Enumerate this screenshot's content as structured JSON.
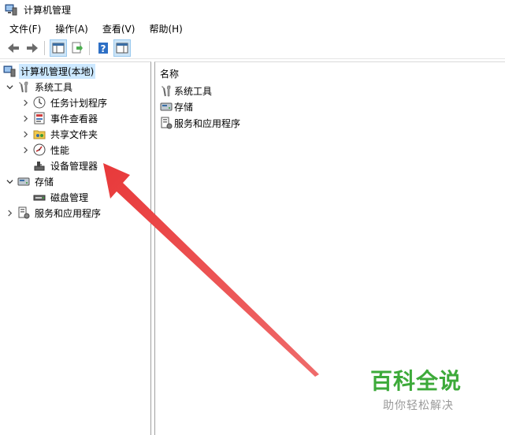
{
  "window": {
    "title": "计算机管理"
  },
  "menu": [
    "文件(F)",
    "操作(A)",
    "查看(V)",
    "帮助(H)"
  ],
  "toolbar": {
    "buttons": [
      "back-icon",
      "forward-icon",
      "show-console-tree-icon",
      "export-list-icon",
      "help-icon",
      "show-action-pane-icon"
    ]
  },
  "tree": {
    "root": "计算机管理(本地)",
    "system_tools": {
      "label": "系统工具",
      "children": [
        "任务计划程序",
        "事件查看器",
        "共享文件夹",
        "性能",
        "设备管理器"
      ]
    },
    "storage": {
      "label": "存储",
      "children": [
        "磁盘管理"
      ]
    },
    "services": {
      "label": "服务和应用程序"
    }
  },
  "list": {
    "column_name": "名称",
    "items": [
      "系统工具",
      "存储",
      "服务和应用程序"
    ]
  },
  "watermark": {
    "main": "百科全说",
    "sub": "助你轻松解决"
  },
  "colors": {
    "arrow": "#e8393a",
    "watermark": "#3daa3a",
    "selection": "#cce8ff"
  }
}
